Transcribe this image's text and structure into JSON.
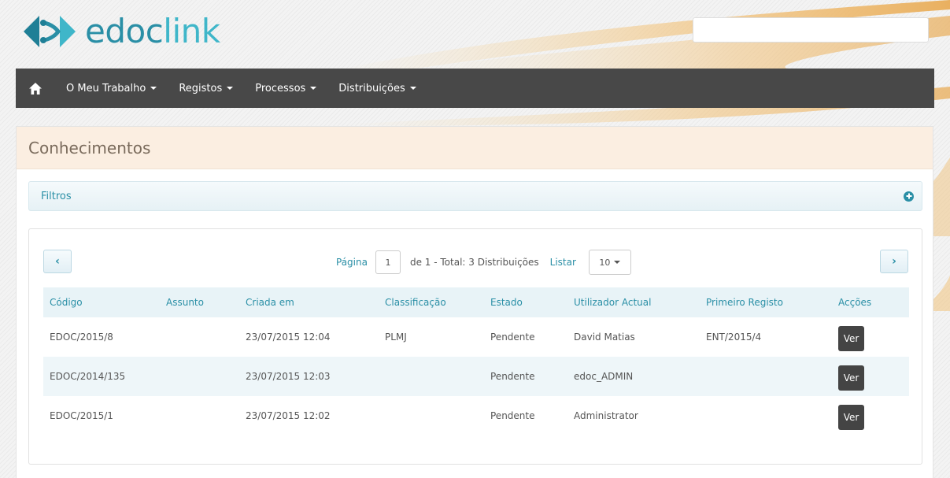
{
  "brand": {
    "part1": "edoc",
    "part2": "link"
  },
  "search": {
    "value": "",
    "placeholder": ""
  },
  "nav": {
    "items": [
      {
        "label": "O Meu Trabalho"
      },
      {
        "label": "Registos"
      },
      {
        "label": "Processos"
      },
      {
        "label": "Distribuições"
      }
    ]
  },
  "page": {
    "title": "Conhecimentos"
  },
  "filters": {
    "label": "Filtros"
  },
  "pager": {
    "page_label": "Página",
    "page_value": "1",
    "total_text": "de 1 - Total: 3 Distribuições",
    "list_label": "Listar",
    "list_value": "10"
  },
  "table": {
    "columns": [
      "Código",
      "Assunto",
      "Criada em",
      "Classificação",
      "Estado",
      "Utilizador Actual",
      "Primeiro Registo",
      "Acções"
    ],
    "rows": [
      {
        "codigo": "EDOC/2015/8",
        "assunto": "",
        "criada": "23/07/2015 12:04",
        "classificacao": "PLMJ",
        "estado": "Pendente",
        "utilizador": "David Matias",
        "registo": "ENT/2015/4",
        "accao": "Ver"
      },
      {
        "codigo": "EDOC/2014/135",
        "assunto": "",
        "criada": "23/07/2015 12:03",
        "classificacao": "",
        "estado": "Pendente",
        "utilizador": "edoc_ADMIN",
        "registo": "",
        "accao": "Ver"
      },
      {
        "codigo": "EDOC/2015/1",
        "assunto": "",
        "criada": "23/07/2015 12:02",
        "classificacao": "",
        "estado": "Pendente",
        "utilizador": "Administrator",
        "registo": "",
        "accao": "Ver"
      }
    ]
  },
  "colors": {
    "accent": "#2a8fa6",
    "navbar": "#484848",
    "heading_bg": "#fbeee1",
    "swoosh": "#e8b86a"
  }
}
